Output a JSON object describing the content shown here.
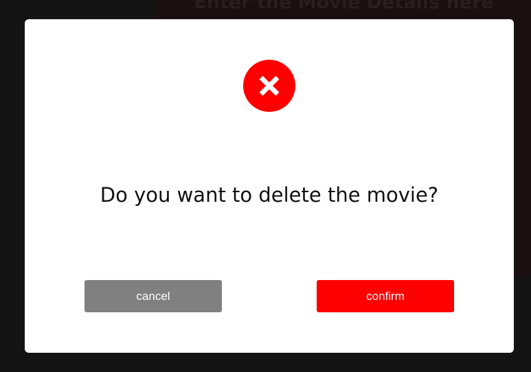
{
  "background": {
    "heading": "Enter the Movie Details here"
  },
  "dialog": {
    "icon": "close-x-icon",
    "message": "Do you want to delete the movie?",
    "cancel_label": "cancel",
    "confirm_label": "confirm"
  },
  "colors": {
    "danger": "#ff0000",
    "cancel": "#808080",
    "overlay": "#141414",
    "dialog_bg": "#ffffff"
  }
}
